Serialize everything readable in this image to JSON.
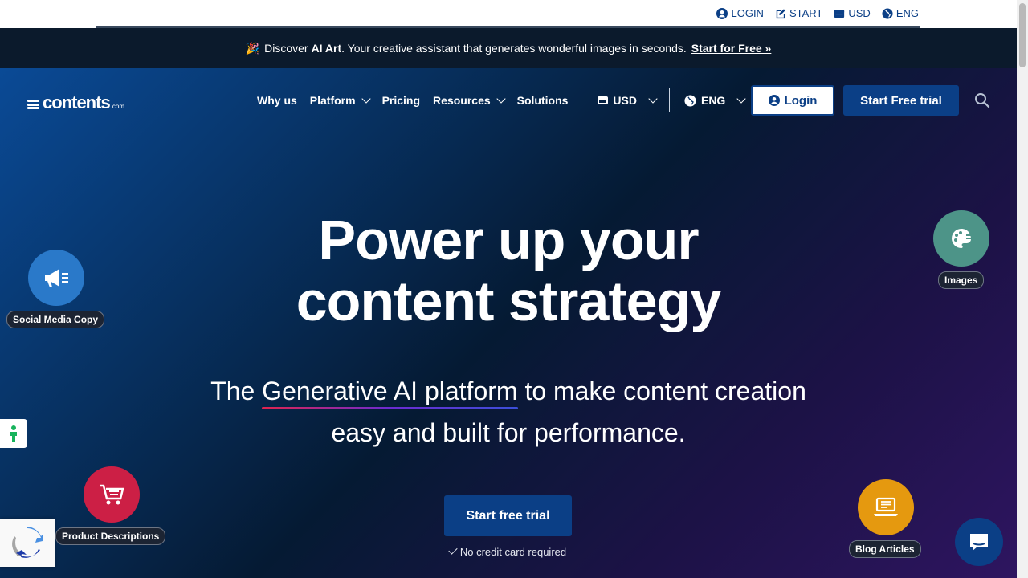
{
  "utilbar": {
    "login": "LOGIN",
    "start": "START",
    "currency": "USD",
    "language": "ENG"
  },
  "announce": {
    "prefix": "Discover",
    "product": "AI Art",
    "text": ". Your creative assistant that generates wonderful images in seconds.",
    "link": "Start for Free »"
  },
  "logo": {
    "name": "contents",
    "tld": ".com"
  },
  "nav": {
    "items": [
      "Why us",
      "Platform",
      "Pricing",
      "Resources",
      "Solutions"
    ],
    "currency": "USD",
    "language": "ENG",
    "login": "Login",
    "trial": "Start Free trial"
  },
  "hero": {
    "headline_1": "Power up your",
    "headline_2": "content strategy",
    "sub_pre": "The",
    "sub_highlight": "Generative AI platform",
    "sub_post": "to make content creation easy and built for performance.",
    "cta": "Start free trial",
    "note": "No credit card required"
  },
  "bubbles": {
    "social": "Social Media Copy",
    "images": "Images",
    "product": "Product Descriptions",
    "blog": "Blog Articles"
  },
  "colors": {
    "brand": "#0b3f86",
    "announce_bg": "#0b1a2c",
    "social": "#2a79c9",
    "images": "#4d9488",
    "product": "#cc1f45",
    "blog": "#e5990f"
  }
}
